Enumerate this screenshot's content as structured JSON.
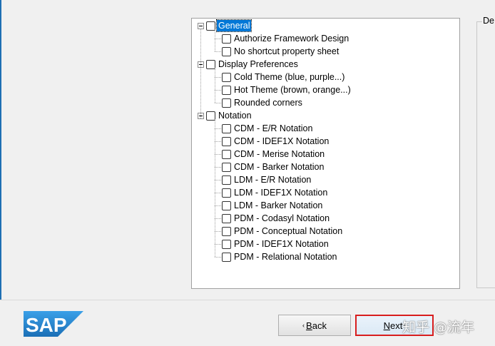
{
  "tree": {
    "groups": [
      {
        "label": "General",
        "selected": true,
        "items": [
          "Authorize Framework Design",
          "No shortcut property sheet"
        ]
      },
      {
        "label": "Display Preferences",
        "selected": false,
        "items": [
          "Cold Theme (blue, purple...)",
          "Hot Theme (brown, orange...)",
          "Rounded corners"
        ]
      },
      {
        "label": "Notation",
        "selected": false,
        "items": [
          "CDM - E/R Notation",
          "CDM - IDEF1X Notation",
          "CDM - Merise Notation",
          "CDM - Barker Notation",
          "LDM - E/R Notation",
          "LDM - IDEF1X Notation",
          "LDM - Barker Notation",
          "PDM - Codasyl Notation",
          "PDM - Conceptual Notation",
          "PDM - IDEF1X Notation",
          "PDM - Relational Notation"
        ]
      }
    ]
  },
  "description": {
    "legend": "De"
  },
  "logo": {
    "text": "SAP",
    "color": "#1b75bc"
  },
  "buttons": {
    "back_prefix": "< ",
    "back_mnemonic": "B",
    "back_rest": "ack",
    "next_prefix": "",
    "next_mnemonic": "N",
    "next_rest": "ext",
    "next_suffix": " >"
  },
  "watermark": {
    "text": "知乎 @流年"
  },
  "colors": {
    "selection": "#0078d7",
    "highlight_box": "#d81e1e"
  }
}
